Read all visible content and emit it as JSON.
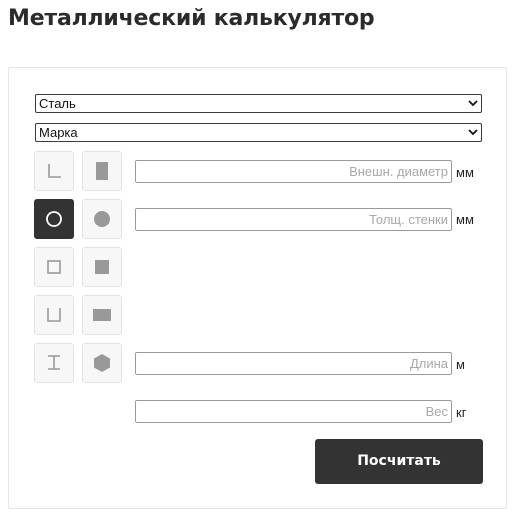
{
  "page": {
    "title": "Металлический калькулятор"
  },
  "form": {
    "material_select": {
      "value": "Сталь"
    },
    "grade_select": {
      "value": "Марка"
    },
    "shapes": [
      {
        "icon": "angle-profile-icon",
        "active": false
      },
      {
        "icon": "sheet-icon",
        "active": false
      },
      {
        "icon": "pipe-round-icon",
        "active": true
      },
      {
        "icon": "rod-round-icon",
        "active": false
      },
      {
        "icon": "pipe-square-icon",
        "active": false
      },
      {
        "icon": "rod-square-icon",
        "active": false
      },
      {
        "icon": "channel-icon",
        "active": false
      },
      {
        "icon": "strip-icon",
        "active": false
      },
      {
        "icon": "i-beam-icon",
        "active": false
      },
      {
        "icon": "hexagon-icon",
        "active": false
      }
    ],
    "outer_diameter": {
      "placeholder": "Внешн. диаметр",
      "unit": "мм"
    },
    "wall_thickness": {
      "placeholder": "Толщ. стенки",
      "unit": "мм"
    },
    "length": {
      "placeholder": "Длина",
      "unit": "м"
    },
    "weight": {
      "placeholder": "Вес",
      "unit": "кг"
    },
    "submit_label": "Посчитать"
  },
  "colors": {
    "active_bg": "#333333",
    "button_bg": "#333333",
    "icon_gray": "#999999"
  }
}
